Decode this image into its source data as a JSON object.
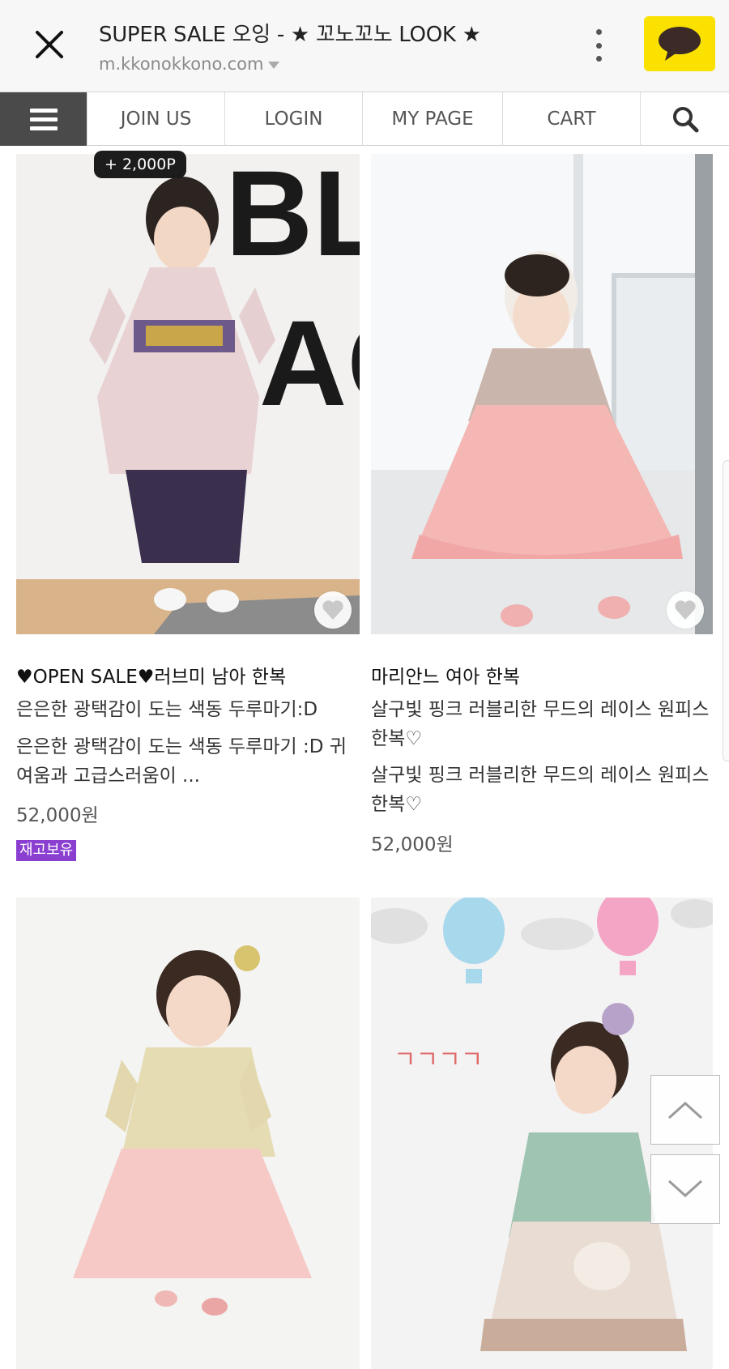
{
  "browser": {
    "title": "SUPER SALE 오잉 - ★ 꼬노꼬노 LOOK ★",
    "url": "m.kkonokkono.com"
  },
  "nav": {
    "items": [
      "JOIN US",
      "LOGIN",
      "MY PAGE",
      "CART"
    ]
  },
  "points_tag": "+ 2,000P",
  "products": [
    {
      "name": "♥OPEN SALE♥러브미 남아 한복",
      "summary": "은은한 광택감이 도는 색동 두루마기:D",
      "description": "은은한 광택감이 도는 색동 두루마기 :D 귀여움과 고급스러움이 ...",
      "price": "52,000원",
      "badge": "재고보유"
    },
    {
      "name": "마리안느 여아 한복",
      "summary": "살구빛 핑크 러블리한 무드의 레이스 원피스 한복♡",
      "description": "살구빛 핑크 러블리한 무드의 레이스 원피스 한복♡",
      "price": "52,000원"
    },
    {
      "name": "",
      "price": ""
    },
    {
      "name": "",
      "price": ""
    }
  ],
  "colors": {
    "kakao_yellow": "#fae100",
    "menu_bg": "#4a4a4a",
    "badge_purple": "#8a3fd1"
  }
}
